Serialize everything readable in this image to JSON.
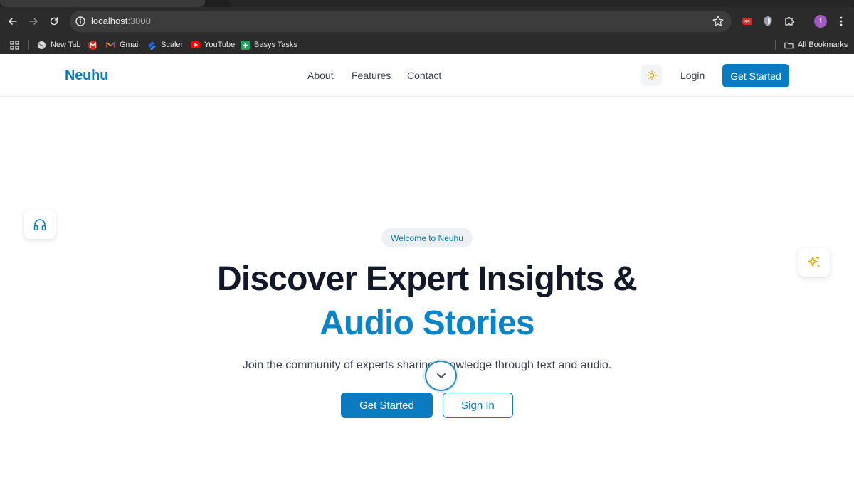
{
  "browser": {
    "url_host": "localhost",
    "url_port": ":3000",
    "profile_initial": "t",
    "bookmarks": [
      {
        "label": "New Tab",
        "icon": "globe-icon"
      },
      {
        "label": "",
        "icon": "red-m-icon"
      },
      {
        "label": "Gmail",
        "icon": "gmail-icon"
      },
      {
        "label": "Scaler",
        "icon": "scaler-icon"
      },
      {
        "label": "YouTube",
        "icon": "youtube-icon"
      },
      {
        "label": "Basys Tasks",
        "icon": "plus-green-icon"
      }
    ],
    "all_bookmarks_label": "All Bookmarks"
  },
  "site": {
    "logo": "Neuhu",
    "nav": [
      "About",
      "Features",
      "Contact"
    ],
    "login": "Login",
    "header_cta": "Get Started"
  },
  "hero": {
    "badge": "Welcome to Neuhu",
    "title_line1": "Discover Expert Insights &",
    "title_line2": "Audio Stories",
    "subtitle": "Join the community of experts sharing knowledge through text and audio.",
    "primary_button": "Get Started",
    "secondary_button": "Sign In"
  },
  "colors": {
    "brand": "#0a7bc1",
    "accent_text": "#0a84c6",
    "heading": "#111827",
    "sparkle": "#e0a800"
  }
}
